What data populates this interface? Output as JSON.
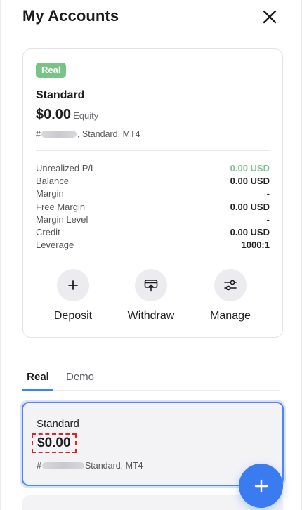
{
  "header": {
    "title": "My Accounts"
  },
  "card": {
    "badge": "Real",
    "account_type": "Standard",
    "equity_amount": "$0.00",
    "equity_label": "Equity",
    "id_prefix": "#",
    "id_suffix": ", Standard, MT4",
    "stats": [
      {
        "label": "Unrealized P/L",
        "value": "0.00 USD"
      },
      {
        "label": "Balance",
        "value": "0.00 USD"
      },
      {
        "label": "Margin",
        "value": "-"
      },
      {
        "label": "Free Margin",
        "value": "0.00 USD"
      },
      {
        "label": "Margin Level",
        "value": "-"
      },
      {
        "label": "Credit",
        "value": "0.00 USD"
      },
      {
        "label": "Leverage",
        "value": "1000:1"
      }
    ],
    "actions": [
      {
        "label": "Deposit",
        "icon": "plus-icon"
      },
      {
        "label": "Withdraw",
        "icon": "withdraw-icon"
      },
      {
        "label": "Manage",
        "icon": "settings-sliders-icon"
      }
    ]
  },
  "tabs": [
    {
      "label": "Real"
    },
    {
      "label": "Demo"
    }
  ],
  "account_list": [
    {
      "type": "Standard",
      "amount": "$0.00",
      "id_prefix": "#",
      "id_suffix": " Standard, MT4"
    }
  ],
  "colors": {
    "accent": "#3b7bf0",
    "positive": "#7cc48a",
    "badge": "#79c386",
    "highlight_border": "#d62828"
  }
}
